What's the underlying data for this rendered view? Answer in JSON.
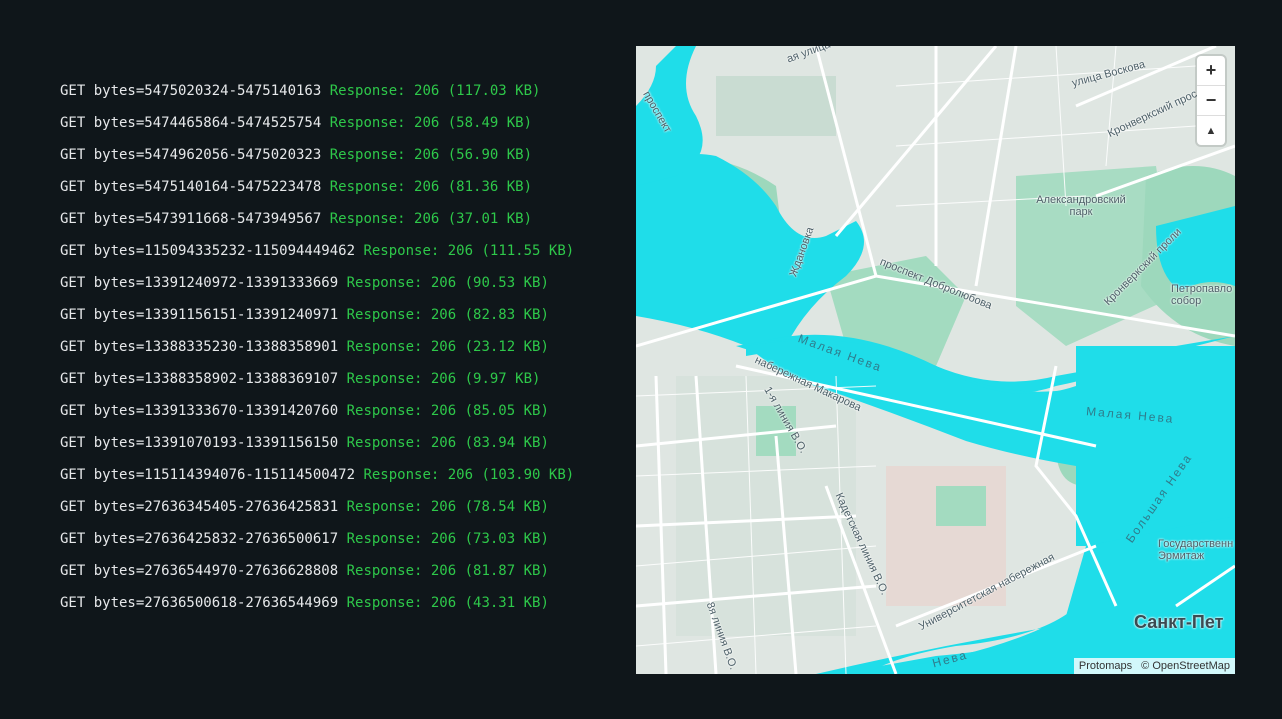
{
  "log": [
    {
      "request": "GET bytes=5475020324-5475140163",
      "response": "Response: 206 (117.03 KB)"
    },
    {
      "request": "GET bytes=5474465864-5474525754",
      "response": "Response: 206 (58.49 KB)"
    },
    {
      "request": "GET bytes=5474962056-5475020323",
      "response": "Response: 206 (56.90 KB)"
    },
    {
      "request": "GET bytes=5475140164-5475223478",
      "response": "Response: 206 (81.36 KB)"
    },
    {
      "request": "GET bytes=5473911668-5473949567",
      "response": "Response: 206 (37.01 KB)"
    },
    {
      "request": "GET bytes=115094335232-115094449462",
      "response": "Response: 206 (111.55 KB)"
    },
    {
      "request": "GET bytes=13391240972-13391333669",
      "response": "Response: 206 (90.53 KB)"
    },
    {
      "request": "GET bytes=13391156151-13391240971",
      "response": "Response: 206 (82.83 KB)"
    },
    {
      "request": "GET bytes=13388335230-13388358901",
      "response": "Response: 206 (23.12 KB)"
    },
    {
      "request": "GET bytes=13388358902-13388369107",
      "response": "Response: 206 (9.97 KB)"
    },
    {
      "request": "GET bytes=13391333670-13391420760",
      "response": "Response: 206 (85.05 KB)"
    },
    {
      "request": "GET bytes=13391070193-13391156150",
      "response": "Response: 206 (83.94 KB)"
    },
    {
      "request": "GET bytes=115114394076-115114500472",
      "response": "Response: 206 (103.90 KB)"
    },
    {
      "request": "GET bytes=27636345405-27636425831",
      "response": "Response: 206 (78.54 KB)"
    },
    {
      "request": "GET bytes=27636425832-27636500617",
      "response": "Response: 206 (73.03 KB)"
    },
    {
      "request": "GET bytes=27636544970-27636628808",
      "response": "Response: 206 (81.87 KB)"
    },
    {
      "request": "GET bytes=27636500618-27636544969",
      "response": "Response: 206 (43.31 KB)"
    }
  ],
  "map": {
    "controls": {
      "zoom_in": "+",
      "zoom_out": "−",
      "compass": "▲"
    },
    "attribution": {
      "protomaps": "Protomaps",
      "osm": "© OpenStreetMap"
    },
    "labels": {
      "street_top": "ая улица",
      "voskova": "улица Воскова",
      "prospekt_left": "проспект",
      "kronverksky_top": "Кронверкский прос",
      "aleksandrovsky": "Александровский парк",
      "zhdanovka": "Ждановка",
      "dobrolyubova": "проспект Добролюбова",
      "kronverksky_strait": "Кронверкский проли",
      "petropavl": "Петропавло собор",
      "malaya_neva_1": "Малая Нева",
      "malaya_neva_2": "Малая Нева",
      "makarova": "набережная Макарова",
      "liniya_1": "1-я линия В.О.",
      "kadetskaya": "Кадетская линия В.О.",
      "universitetskaya": "Университетская набережная",
      "bolshaya_neva": "Большая Нева",
      "hermitage": "Государственн Эрмитаж",
      "city": "Санкт-Пет",
      "liniya_8": "8я линия В.О.",
      "neva_bottom": "Нева"
    }
  },
  "colors": {
    "background": "#0f161a",
    "request_text": "#e6e8ea",
    "response_text": "#2ec84a",
    "water": "#1fdde9",
    "park": "#9dd8bc",
    "land": "#dfe6e2"
  }
}
